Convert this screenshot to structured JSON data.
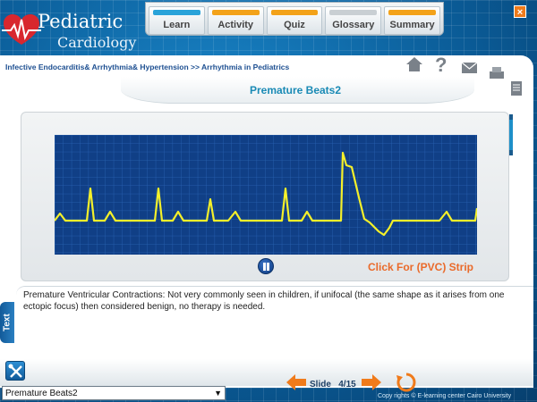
{
  "app": {
    "logo_line1": "Pediatric",
    "logo_line2": "Cardiology"
  },
  "nav": {
    "tabs": [
      {
        "label": "Learn",
        "bar_color": "#2aa3d9"
      },
      {
        "label": "Activity",
        "bar_color": "#f3a219"
      },
      {
        "label": "Quiz",
        "bar_color": "#f3a219"
      },
      {
        "label": "Glossary",
        "bar_color": "#c9cfd3"
      },
      {
        "label": "Summary",
        "bar_color": "#f3a219"
      }
    ],
    "close_label": "×"
  },
  "breadcrumb": "Infective Endocarditis& Arrhythmia& Hypertension >> Arrhythmia in Pediatrics",
  "toolbar_icons": [
    "home-icon",
    "help-icon",
    "email-icon",
    "print-icon",
    "notes-icon"
  ],
  "slide": {
    "title": "Premature Beats2",
    "pvc_link": "Click For (PVC) Strip",
    "body": "Premature Ventricular Contractions: Not very commonly seen in children, if unifocal (the same shape as it arises from one ectopic focus) then considered benign, no therapy is needed."
  },
  "side_tab": "Text",
  "footer": {
    "slide_label": "Slide",
    "slide_counter": "4/15",
    "select_value": "Premature Beats2",
    "copyright": "Copy rights © E-learning center Cairo University"
  },
  "colors": {
    "accent": "#1a8ab5",
    "pvc_orange": "#ea6a2a",
    "ecg_line": "#f4f02a",
    "ecg_bg": "#103f86"
  }
}
